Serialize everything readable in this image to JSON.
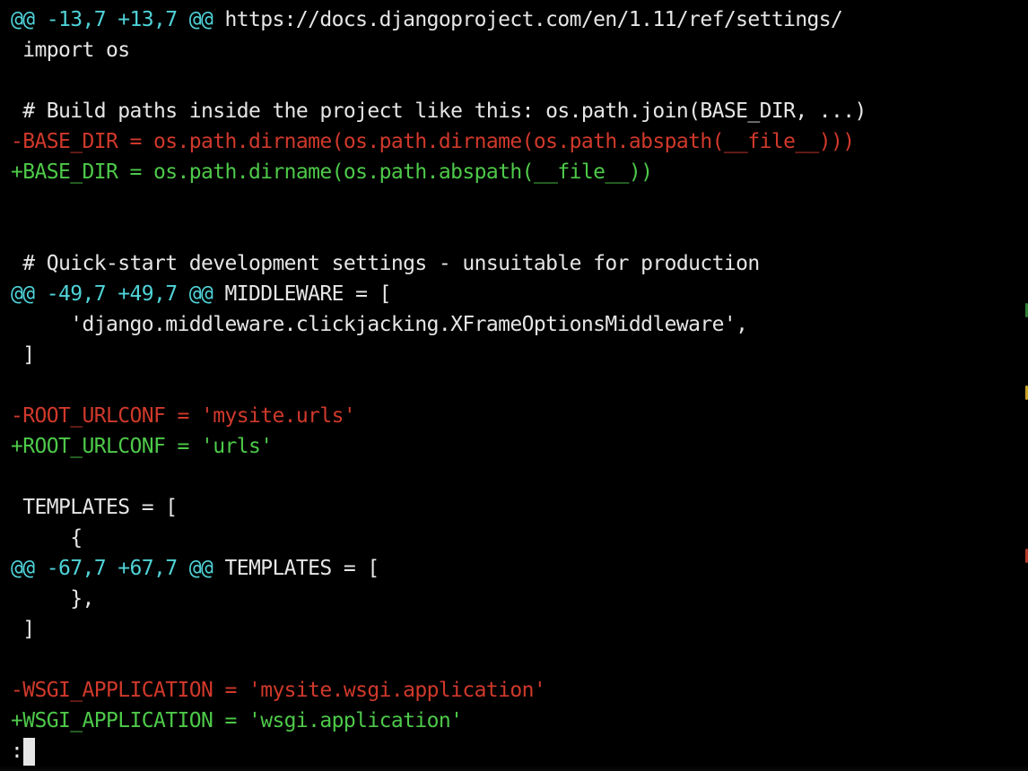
{
  "lines": [
    {
      "kind": "hunk",
      "at": "@@ -13,7 +13,7 @@",
      "rest": " https://docs.djangoproject.com/en/1.11/ref/settings/"
    },
    {
      "kind": "context",
      "text": " import os"
    },
    {
      "kind": "context",
      "text": ""
    },
    {
      "kind": "context",
      "text": " # Build paths inside the project like this: os.path.join(BASE_DIR, ...)"
    },
    {
      "kind": "removed",
      "text": "-BASE_DIR = os.path.dirname(os.path.dirname(os.path.abspath(__file__)))"
    },
    {
      "kind": "added",
      "text": "+BASE_DIR = os.path.dirname(os.path.abspath(__file__))"
    },
    {
      "kind": "context",
      "text": ""
    },
    {
      "kind": "context",
      "text": ""
    },
    {
      "kind": "context",
      "text": " # Quick-start development settings - unsuitable for production"
    },
    {
      "kind": "hunk",
      "at": "@@ -49,7 +49,7 @@",
      "rest": " MIDDLEWARE = ["
    },
    {
      "kind": "context",
      "text": "     'django.middleware.clickjacking.XFrameOptionsMiddleware',"
    },
    {
      "kind": "context",
      "text": " ]"
    },
    {
      "kind": "context",
      "text": ""
    },
    {
      "kind": "removed",
      "text": "-ROOT_URLCONF = 'mysite.urls'"
    },
    {
      "kind": "added",
      "text": "+ROOT_URLCONF = 'urls'"
    },
    {
      "kind": "context",
      "text": ""
    },
    {
      "kind": "context",
      "text": " TEMPLATES = ["
    },
    {
      "kind": "context",
      "text": "     {"
    },
    {
      "kind": "hunk",
      "at": "@@ -67,7 +67,7 @@",
      "rest": " TEMPLATES = ["
    },
    {
      "kind": "context",
      "text": "     },"
    },
    {
      "kind": "context",
      "text": " ]"
    },
    {
      "kind": "context",
      "text": ""
    },
    {
      "kind": "removed",
      "text": "-WSGI_APPLICATION = 'mysite.wsgi.application'"
    },
    {
      "kind": "added",
      "text": "+WSGI_APPLICATION = 'wsgi.application'"
    }
  ],
  "pager": {
    "prompt": ":"
  },
  "colors": {
    "background": "#000000",
    "hunk_marker": "#4fd3d8",
    "removed": "#d0392b",
    "added": "#4ec94a",
    "context": "#e6e6e6"
  }
}
